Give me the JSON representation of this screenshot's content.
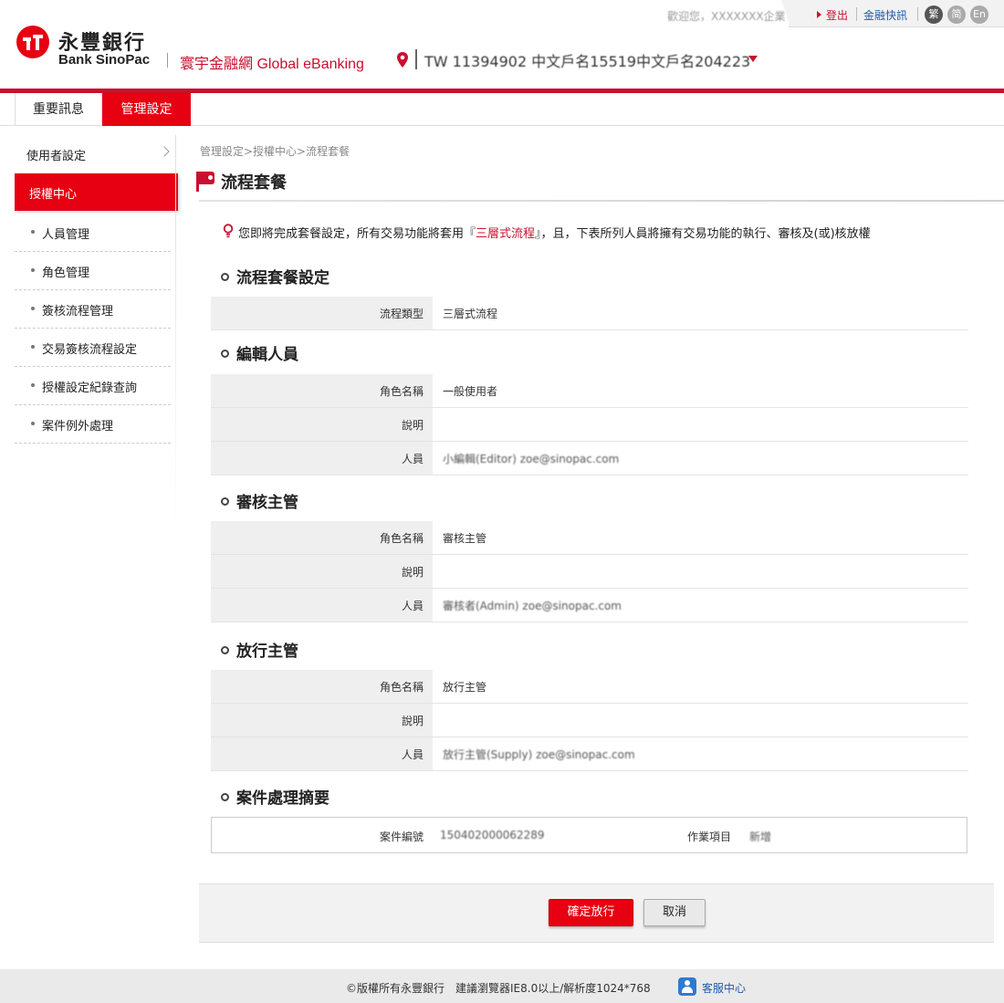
{
  "header": {
    "brand_cn": "永豐銀行",
    "brand_en": "Bank SinoPac",
    "subtitle": "寰宇金融網 Global eBanking",
    "account": "TW 11394902 中文戶名15519中文戶名204223",
    "welcome": "歡迎您，XXXXXXX企業",
    "logout": "登出",
    "news": "金融快訊",
    "langs": [
      "繁",
      "简",
      "En"
    ]
  },
  "tabs": [
    {
      "label": "重要訊息",
      "active": false
    },
    {
      "label": "管理設定",
      "active": true
    }
  ],
  "sidebar": {
    "parent": "使用者設定",
    "active": "授權中心",
    "items": [
      "人員管理",
      "角色管理",
      "簽核流程管理",
      "交易簽核流程設定",
      "授權設定紀錄查詢",
      "案件例外處理"
    ]
  },
  "main": {
    "breadcrumb": "管理設定>授權中心>流程套餐",
    "title": "流程套餐",
    "notice_pre": "您即將完成套餐設定，所有交易功能將套用『",
    "notice_highlight": "三層式流程",
    "notice_post": "』，且，下表所列人員將擁有交易功能的執行、審核及(或)核放權",
    "sections": [
      {
        "heading": "流程套餐設定",
        "rows": [
          {
            "label": "流程類型",
            "value": "三層式流程"
          }
        ]
      },
      {
        "heading": "編輯人員",
        "rows": [
          {
            "label": "角色名稱",
            "value": "一般使用者"
          },
          {
            "label": "說明",
            "value": ""
          },
          {
            "label": "人員",
            "value": "小編輯(Editor) zoe@sinopac.com"
          }
        ]
      },
      {
        "heading": "審核主管",
        "rows": [
          {
            "label": "角色名稱",
            "value": "審核主管"
          },
          {
            "label": "說明",
            "value": ""
          },
          {
            "label": "人員",
            "value": "審核者(Admin) zoe@sinopac.com"
          }
        ]
      },
      {
        "heading": "放行主管",
        "rows": [
          {
            "label": "角色名稱",
            "value": "放行主管"
          },
          {
            "label": "說明",
            "value": ""
          },
          {
            "label": "人員",
            "value": "放行主管(Supply) zoe@sinopac.com"
          }
        ]
      }
    ],
    "summary": {
      "heading": "案件處理摘要",
      "case_no_label": "案件編號",
      "case_no": "150402000062289",
      "op_label": "作業項目",
      "op_value": "新增"
    },
    "buttons": {
      "confirm": "確定放行",
      "cancel": "取消"
    }
  },
  "footer": {
    "text": "©版權所有永豐銀行　建議瀏覽器IE8.0以上/解析度1024*768",
    "service": "客服中心"
  },
  "colors": {
    "brand_red": "#e60012",
    "link_blue": "#1f5ba8"
  }
}
